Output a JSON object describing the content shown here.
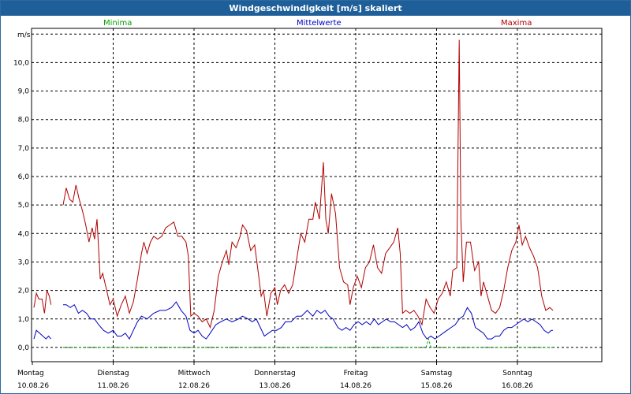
{
  "window": {
    "title": "Windgeschwindigkeit [m/s] skaliert"
  },
  "legend": {
    "min_label": "Minima",
    "mean_label": "Mittelwerte",
    "max_label": "Maxima"
  },
  "colors": {
    "min": "#00a000",
    "mean": "#0000c0",
    "max": "#b00000",
    "titlebar": "#1f5f99"
  },
  "chart_data": {
    "type": "line",
    "title": "Windgeschwindigkeit [m/s] skaliert",
    "ylabel": "m/s",
    "ylim": [
      -0.5,
      11.2
    ],
    "yticks": [
      "0,0",
      "1,0",
      "2,0",
      "3,0",
      "4,0",
      "5,0",
      "6,0",
      "7,0",
      "8,0",
      "9,0",
      "10,0"
    ],
    "xlim": [
      0,
      7.0
    ],
    "xticks": [
      {
        "day": "Montag",
        "date": "10.08.26"
      },
      {
        "day": "Dienstag",
        "date": "11.08.26"
      },
      {
        "day": "Mittwoch",
        "date": "12.08.26"
      },
      {
        "day": "Donnerstag",
        "date": "13.08.26"
      },
      {
        "day": "Freitag",
        "date": "14.08.26"
      },
      {
        "day": "Samstag",
        "date": "15.08.26"
      },
      {
        "day": "Sonntag",
        "date": "16.08.26"
      }
    ],
    "grid": true,
    "legend_position": "top",
    "series": [
      {
        "name": "Maxima",
        "color": "#b00000",
        "segments": [
          [
            [
              0.02,
              1.4
            ],
            [
              0.05,
              1.9
            ],
            [
              0.08,
              1.7
            ],
            [
              0.12,
              1.7
            ],
            [
              0.15,
              1.2
            ],
            [
              0.18,
              2.0
            ],
            [
              0.21,
              1.8
            ],
            [
              0.23,
              1.5
            ]
          ],
          [
            [
              0.38,
              5.0
            ],
            [
              0.42,
              5.6
            ],
            [
              0.46,
              5.2
            ],
            [
              0.5,
              5.1
            ],
            [
              0.54,
              5.7
            ],
            [
              0.58,
              5.2
            ],
            [
              0.62,
              4.8
            ],
            [
              0.66,
              4.3
            ],
            [
              0.7,
              3.7
            ],
            [
              0.74,
              4.2
            ],
            [
              0.77,
              3.8
            ],
            [
              0.8,
              4.5
            ],
            [
              0.84,
              2.4
            ],
            [
              0.87,
              2.6
            ],
            [
              0.92,
              2.0
            ],
            [
              0.96,
              1.5
            ],
            [
              1.0,
              1.7
            ],
            [
              1.05,
              1.1
            ],
            [
              1.1,
              1.5
            ],
            [
              1.15,
              1.8
            ],
            [
              1.2,
              1.2
            ],
            [
              1.25,
              1.6
            ],
            [
              1.3,
              2.4
            ],
            [
              1.35,
              3.3
            ],
            [
              1.38,
              3.7
            ],
            [
              1.42,
              3.3
            ],
            [
              1.46,
              3.7
            ],
            [
              1.5,
              3.9
            ],
            [
              1.55,
              3.8
            ],
            [
              1.6,
              3.9
            ],
            [
              1.65,
              4.2
            ],
            [
              1.7,
              4.3
            ],
            [
              1.75,
              4.4
            ],
            [
              1.8,
              3.9
            ],
            [
              1.85,
              3.9
            ],
            [
              1.9,
              3.7
            ],
            [
              1.93,
              3.2
            ],
            [
              1.96,
              1.1
            ],
            [
              2.0,
              1.2
            ],
            [
              2.05,
              1.1
            ],
            [
              2.1,
              0.9
            ],
            [
              2.15,
              1.0
            ],
            [
              2.2,
              0.7
            ],
            [
              2.25,
              1.3
            ],
            [
              2.3,
              2.5
            ],
            [
              2.35,
              3.0
            ],
            [
              2.4,
              3.4
            ],
            [
              2.43,
              2.9
            ],
            [
              2.47,
              3.7
            ],
            [
              2.52,
              3.5
            ],
            [
              2.57,
              3.9
            ],
            [
              2.6,
              4.3
            ],
            [
              2.65,
              4.1
            ],
            [
              2.7,
              3.4
            ],
            [
              2.75,
              3.6
            ],
            [
              2.8,
              2.5
            ],
            [
              2.83,
              1.8
            ],
            [
              2.86,
              2.0
            ],
            [
              2.9,
              1.1
            ],
            [
              2.95,
              1.9
            ],
            [
              3.0,
              2.1
            ],
            [
              3.03,
              1.5
            ],
            [
              3.07,
              2.0
            ],
            [
              3.12,
              2.2
            ],
            [
              3.17,
              1.9
            ],
            [
              3.22,
              2.2
            ],
            [
              3.27,
              3.1
            ],
            [
              3.32,
              4.0
            ],
            [
              3.37,
              3.7
            ],
            [
              3.42,
              4.5
            ],
            [
              3.47,
              4.5
            ],
            [
              3.5,
              5.1
            ],
            [
              3.55,
              4.5
            ],
            [
              3.6,
              6.5
            ],
            [
              3.63,
              4.5
            ],
            [
              3.66,
              4.0
            ],
            [
              3.7,
              5.4
            ],
            [
              3.75,
              4.7
            ],
            [
              3.8,
              2.8
            ],
            [
              3.85,
              2.3
            ],
            [
              3.9,
              2.2
            ],
            [
              3.93,
              1.5
            ],
            [
              3.97,
              2.1
            ],
            [
              4.02,
              2.5
            ],
            [
              4.07,
              2.1
            ],
            [
              4.12,
              2.8
            ],
            [
              4.17,
              3.0
            ],
            [
              4.22,
              3.6
            ],
            [
              4.27,
              2.8
            ],
            [
              4.32,
              2.6
            ],
            [
              4.37,
              3.3
            ],
            [
              4.42,
              3.5
            ],
            [
              4.47,
              3.7
            ],
            [
              4.52,
              4.2
            ],
            [
              4.55,
              3.3
            ],
            [
              4.58,
              1.2
            ],
            [
              4.62,
              1.3
            ],
            [
              4.67,
              1.2
            ],
            [
              4.72,
              1.3
            ],
            [
              4.77,
              1.1
            ],
            [
              4.82,
              0.8
            ],
            [
              4.87,
              1.7
            ],
            [
              4.92,
              1.4
            ],
            [
              4.97,
              1.2
            ],
            [
              5.02,
              1.7
            ],
            [
              5.07,
              1.9
            ],
            [
              5.12,
              2.3
            ],
            [
              5.17,
              1.8
            ],
            [
              5.2,
              2.7
            ],
            [
              5.25,
              2.8
            ],
            [
              5.28,
              10.8
            ],
            [
              5.3,
              4.5
            ],
            [
              5.33,
              2.3
            ],
            [
              5.37,
              3.7
            ],
            [
              5.42,
              3.7
            ],
            [
              5.47,
              2.7
            ],
            [
              5.52,
              3.0
            ],
            [
              5.55,
              1.8
            ],
            [
              5.58,
              2.3
            ],
            [
              5.63,
              1.8
            ],
            [
              5.68,
              1.3
            ],
            [
              5.73,
              1.2
            ],
            [
              5.78,
              1.4
            ],
            [
              5.83,
              2.0
            ],
            [
              5.88,
              2.8
            ],
            [
              5.93,
              3.4
            ],
            [
              5.98,
              3.7
            ],
            [
              6.02,
              4.3
            ],
            [
              6.06,
              3.6
            ],
            [
              6.1,
              3.9
            ],
            [
              6.15,
              3.5
            ],
            [
              6.2,
              3.2
            ],
            [
              6.25,
              2.8
            ],
            [
              6.3,
              1.8
            ],
            [
              6.35,
              1.3
            ],
            [
              6.4,
              1.4
            ],
            [
              6.44,
              1.3
            ]
          ]
        ]
      },
      {
        "name": "Mittelwerte",
        "color": "#0000c0",
        "segments": [
          [
            [
              0.02,
              0.3
            ],
            [
              0.05,
              0.6
            ],
            [
              0.09,
              0.5
            ],
            [
              0.13,
              0.4
            ],
            [
              0.17,
              0.3
            ],
            [
              0.2,
              0.4
            ],
            [
              0.23,
              0.3
            ]
          ],
          [
            [
              0.38,
              1.5
            ],
            [
              0.42,
              1.5
            ],
            [
              0.47,
              1.4
            ],
            [
              0.52,
              1.5
            ],
            [
              0.57,
              1.2
            ],
            [
              0.62,
              1.3
            ],
            [
              0.67,
              1.2
            ],
            [
              0.72,
              1.0
            ],
            [
              0.77,
              1.0
            ],
            [
              0.82,
              0.8
            ],
            [
              0.88,
              0.6
            ],
            [
              0.94,
              0.5
            ],
            [
              1.0,
              0.6
            ],
            [
              1.05,
              0.4
            ],
            [
              1.1,
              0.4
            ],
            [
              1.15,
              0.5
            ],
            [
              1.2,
              0.3
            ],
            [
              1.25,
              0.6
            ],
            [
              1.3,
              0.9
            ],
            [
              1.35,
              1.1
            ],
            [
              1.42,
              1.0
            ],
            [
              1.5,
              1.2
            ],
            [
              1.58,
              1.3
            ],
            [
              1.65,
              1.3
            ],
            [
              1.72,
              1.4
            ],
            [
              1.78,
              1.6
            ],
            [
              1.84,
              1.3
            ],
            [
              1.9,
              1.1
            ],
            [
              1.95,
              0.6
            ],
            [
              2.0,
              0.5
            ],
            [
              2.05,
              0.6
            ],
            [
              2.1,
              0.4
            ],
            [
              2.15,
              0.3
            ],
            [
              2.2,
              0.5
            ],
            [
              2.27,
              0.8
            ],
            [
              2.33,
              0.9
            ],
            [
              2.4,
              1.0
            ],
            [
              2.47,
              0.9
            ],
            [
              2.55,
              1.0
            ],
            [
              2.6,
              1.1
            ],
            [
              2.67,
              1.0
            ],
            [
              2.72,
              0.9
            ],
            [
              2.77,
              1.0
            ],
            [
              2.82,
              0.7
            ],
            [
              2.87,
              0.4
            ],
            [
              2.92,
              0.5
            ],
            [
              2.97,
              0.6
            ],
            [
              3.02,
              0.6
            ],
            [
              3.08,
              0.7
            ],
            [
              3.13,
              0.9
            ],
            [
              3.2,
              0.9
            ],
            [
              3.27,
              1.1
            ],
            [
              3.33,
              1.1
            ],
            [
              3.4,
              1.3
            ],
            [
              3.47,
              1.1
            ],
            [
              3.52,
              1.3
            ],
            [
              3.57,
              1.2
            ],
            [
              3.62,
              1.3
            ],
            [
              3.67,
              1.1
            ],
            [
              3.72,
              1.0
            ],
            [
              3.78,
              0.7
            ],
            [
              3.83,
              0.6
            ],
            [
              3.88,
              0.7
            ],
            [
              3.93,
              0.6
            ],
            [
              3.98,
              0.8
            ],
            [
              4.03,
              0.9
            ],
            [
              4.08,
              0.8
            ],
            [
              4.13,
              0.9
            ],
            [
              4.18,
              0.8
            ],
            [
              4.23,
              1.0
            ],
            [
              4.28,
              0.8
            ],
            [
              4.33,
              0.9
            ],
            [
              4.38,
              1.0
            ],
            [
              4.43,
              0.9
            ],
            [
              4.48,
              0.9
            ],
            [
              4.53,
              0.8
            ],
            [
              4.58,
              0.7
            ],
            [
              4.63,
              0.8
            ],
            [
              4.68,
              0.6
            ],
            [
              4.73,
              0.7
            ],
            [
              4.78,
              0.9
            ],
            [
              4.83,
              0.5
            ],
            [
              4.88,
              0.3
            ],
            [
              4.93,
              0.4
            ],
            [
              4.98,
              0.3
            ],
            [
              5.03,
              0.4
            ],
            [
              5.08,
              0.5
            ],
            [
              5.13,
              0.6
            ],
            [
              5.18,
              0.7
            ],
            [
              5.23,
              0.8
            ],
            [
              5.28,
              1.0
            ],
            [
              5.33,
              1.1
            ],
            [
              5.38,
              1.4
            ],
            [
              5.43,
              1.2
            ],
            [
              5.48,
              0.7
            ],
            [
              5.53,
              0.6
            ],
            [
              5.58,
              0.5
            ],
            [
              5.63,
              0.3
            ],
            [
              5.68,
              0.3
            ],
            [
              5.73,
              0.4
            ],
            [
              5.78,
              0.4
            ],
            [
              5.83,
              0.6
            ],
            [
              5.88,
              0.7
            ],
            [
              5.93,
              0.7
            ],
            [
              5.98,
              0.8
            ],
            [
              6.03,
              0.9
            ],
            [
              6.08,
              1.0
            ],
            [
              6.13,
              0.9
            ],
            [
              6.18,
              1.0
            ],
            [
              6.23,
              0.9
            ],
            [
              6.28,
              0.8
            ],
            [
              6.33,
              0.6
            ],
            [
              6.38,
              0.5
            ],
            [
              6.42,
              0.6
            ],
            [
              6.44,
              0.6
            ]
          ]
        ]
      },
      {
        "name": "Minima",
        "color": "#00a000",
        "segments": [
          [
            [
              0.38,
              0.0
            ],
            [
              4.87,
              0.0
            ],
            [
              4.9,
              0.3
            ],
            [
              4.93,
              0.0
            ],
            [
              6.44,
              0.0
            ]
          ]
        ]
      }
    ]
  }
}
